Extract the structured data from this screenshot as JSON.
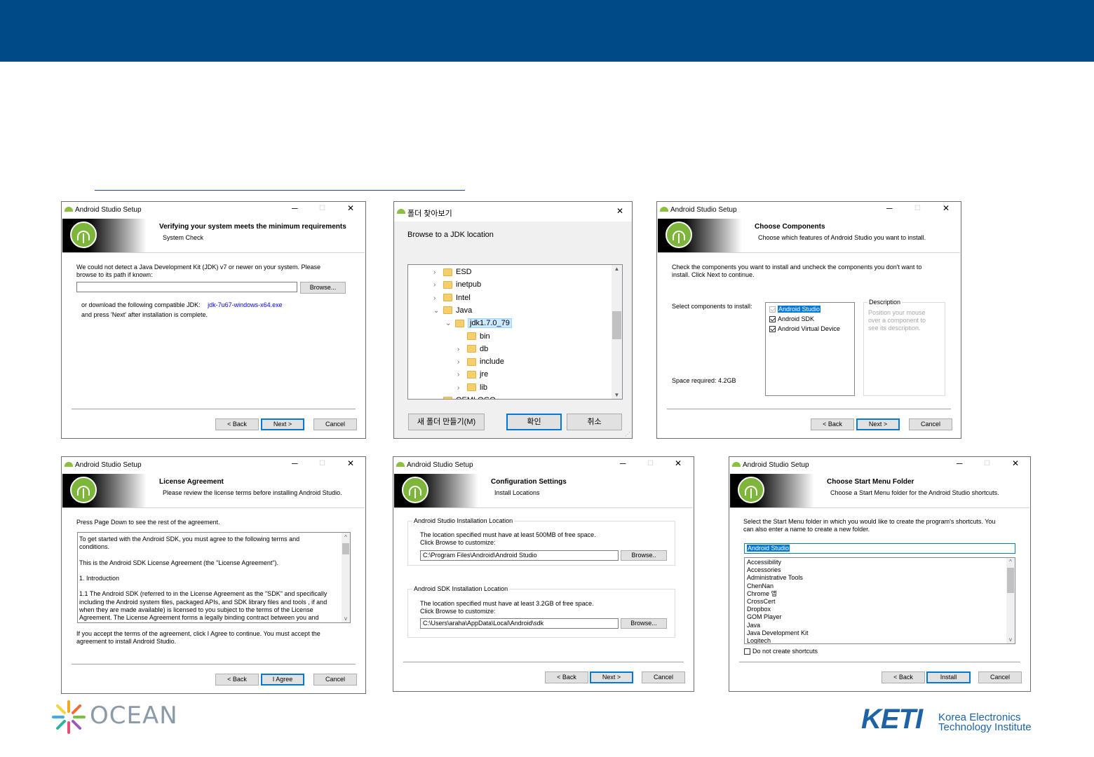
{
  "colors": {
    "banner": "#004b87",
    "android_green": "#7eb63b",
    "selection": "#0078d7",
    "link": "#0000ee",
    "ocean_text": "#8a9aa8",
    "keti_blue": "#1d63a6"
  },
  "win1": {
    "title": "Android Studio Setup",
    "header_title": "Verifying your system meets the minimum requirements",
    "header_subtitle": "System Check",
    "body_line1": "We could not detect a Java Development Kit (JDK) v7 or newer on your system. Please",
    "body_line2": "browse to its path if known:",
    "path_value": "",
    "browse": "Browse...",
    "download_prefix": "or download the following compatible JDK:",
    "download_link": "jdk-7u67-windows-x64.exe",
    "after_install": "and press 'Next' after installation is complete.",
    "back": "< Back",
    "next": "Next >",
    "cancel": "Cancel"
  },
  "win2": {
    "title": "폴더 찾아보기",
    "prompt": "Browse to a JDK location",
    "tree": [
      {
        "label": "ESD",
        "level": 0,
        "expander": "›"
      },
      {
        "label": "inetpub",
        "level": 0,
        "expander": "›"
      },
      {
        "label": "Intel",
        "level": 0,
        "expander": "›"
      },
      {
        "label": "Java",
        "level": 0,
        "expander": "⌄"
      },
      {
        "label": "jdk1.7.0_79",
        "level": 1,
        "expander": "⌄",
        "selected": true
      },
      {
        "label": "bin",
        "level": 2,
        "expander": ""
      },
      {
        "label": "db",
        "level": 2,
        "expander": "›"
      },
      {
        "label": "include",
        "level": 2,
        "expander": "›"
      },
      {
        "label": "jre",
        "level": 2,
        "expander": "›"
      },
      {
        "label": "lib",
        "level": 2,
        "expander": "›"
      },
      {
        "label": "OEMLOGO",
        "level": 0,
        "expander": ""
      }
    ],
    "new_folder": "새 폴더 만들기(M)",
    "ok": "확인",
    "cancel": "취소"
  },
  "win3": {
    "title": "Android Studio Setup",
    "header_title": "Choose Components",
    "header_subtitle": "Choose which features of Android Studio you want to install.",
    "body_line1": "Check the components you want to install and uncheck the components you don't want to",
    "body_line2": "install. Click Next to continue.",
    "select_label": "Select components to install:",
    "components": [
      {
        "label": "Android Studio",
        "checked": true,
        "disabled": true,
        "selected": true
      },
      {
        "label": "Android SDK",
        "checked": true
      },
      {
        "label": "Android Virtual Device",
        "checked": true
      }
    ],
    "desc_title": "Description",
    "desc_text": [
      "Position your mouse",
      "over a component to",
      "see its description."
    ],
    "space": "Space required: 4.2GB",
    "back": "< Back",
    "next": "Next >",
    "cancel": "Cancel"
  },
  "win4": {
    "title": "Android Studio Setup",
    "header_title": "License Agreement",
    "header_subtitle": "Please review the license terms before installing Android Studio.",
    "instruction": "Press Page Down to see the rest of the agreement.",
    "license_lines": [
      "To get started with the Android SDK, you must agree to the following terms and",
      "conditions.",
      "",
      "This is the Android SDK License Agreement (the \"License Agreement\").",
      "",
      "1. Introduction",
      "",
      "1.1 The Android SDK (referred to in the License Agreement as the \"SDK\" and specifically",
      "including the Android system files, packaged APIs, and SDK library files and tools , if and",
      "when they are made available) is licensed to you subject to the terms of the License",
      "Agreement. The License Agreement forms a legally binding contract between you and"
    ],
    "accept_line1": "If you accept the terms of the agreement, click I Agree to continue. You must accept the",
    "accept_line2": "agreement to install Android Studio.",
    "back": "< Back",
    "agree": "I Agree",
    "cancel": "Cancel"
  },
  "win5": {
    "title": "Android Studio Setup",
    "header_title": "Configuration Settings",
    "header_subtitle": "Install Locations",
    "group1_label": "Android Studio Installation Location",
    "group1_line1": "The location specified must have at least 500MB of free space.",
    "group1_line2": "Click Browse to customize:",
    "group1_path": "C:\\Program Files\\Android\\Android Studio",
    "group1_browse": "Browse..",
    "group2_label": "Android SDK Installation Location",
    "group2_line1": "The location specified must have at least 3.2GB of free space.",
    "group2_line2": "Click Browse to customize:",
    "group2_path": "C:\\Users\\araha\\AppData\\Local\\Android\\sdk",
    "group2_browse": "Browse...",
    "back": "< Back",
    "next": "Next >",
    "cancel": "Cancel"
  },
  "win6": {
    "title": "Android Studio Setup",
    "header_title": "Choose Start Menu Folder",
    "header_subtitle": "Choose a Start Menu folder for the Android Studio shortcuts.",
    "body_line1": "Select the Start Menu folder in which you would like to create the program's shortcuts. You",
    "body_line2": "can also enter a name to create a new folder.",
    "folder_value": "Android Studio",
    "folders": [
      "Accessibility",
      "Accessories",
      "Administrative Tools",
      "ChenNan",
      "Chrome 앱",
      "CrossCert",
      "Dropbox",
      "GOM Player",
      "Java",
      "Java Development Kit",
      "Logitech"
    ],
    "no_shortcuts": "Do not create shortcuts",
    "back": "< Back",
    "install": "Install",
    "cancel": "Cancel"
  },
  "footer": {
    "ocean": "OCEAN",
    "keti_logo": "KETI",
    "keti_line1": "Korea Electronics",
    "keti_line2": "Technology Institute"
  }
}
